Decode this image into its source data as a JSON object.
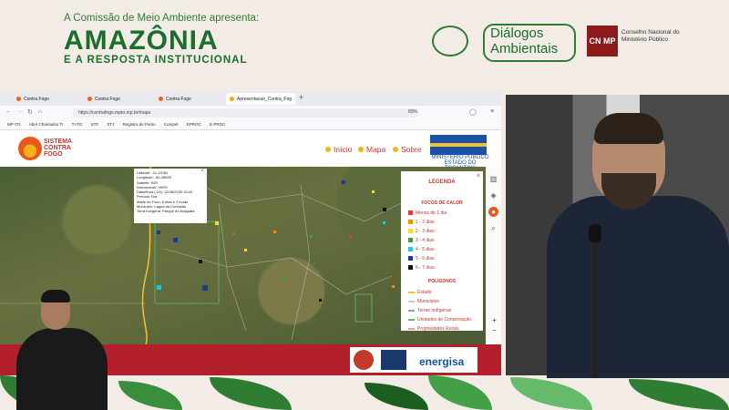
{
  "header": {
    "subtitle": "A Comissão de Meio Ambiente apresenta:",
    "title": "AMAZÔNIA",
    "tagline": "E A RESPOSTA INSTITUCIONAL",
    "dialogos_line1": "Diálogos",
    "dialogos_line2": "Ambientais",
    "cnmp_abbr": "CN MP",
    "cnmp_name": "Conselho Nacional do Ministério Público"
  },
  "browser": {
    "tabs": [
      {
        "label": "Contra Fogo"
      },
      {
        "label": "Contra Fogo"
      },
      {
        "label": "Contra Fogo"
      },
      {
        "label": "Apresentacao_Contra_Fogo_Dia"
      }
    ],
    "url": "https://contrafogo.mpto.mp.br/mapa",
    "zoom": "80%",
    "bookmarks": [
      "MP-TO",
      "Abrir Chamados TI",
      "TI-TO",
      "STF",
      "STJ",
      "Registro de Ponto",
      "Compel",
      "EPROC",
      "E-PROC"
    ]
  },
  "site": {
    "logo_line1": "SISTEMA",
    "logo_line2": "CONTRA",
    "logo_line3": "FOGO",
    "nav": [
      "Início",
      "Mapa",
      "Sobre"
    ],
    "mp_line1": "MINISTÉRIO PÚBLICO",
    "mp_line2": "ESTADO DO TOCANTINS"
  },
  "popup": {
    "lines": [
      "Latitude: -11.12081",
      "Longitude: -50.49695",
      "Satelite: N20",
      "Instrumento: VIIRS",
      "Data/Hora (-03): 12/08/2025 15:43",
      "Período: Dia",
      "Idade do Foco: 6 dias e 2 horas",
      "Município: Lagoa da Confusão",
      "Terra Indígena: Parque do Araguaia"
    ]
  },
  "legend": {
    "title": "LEGENDA",
    "focos_title": "FOCOS DE CALOR",
    "focos": [
      {
        "label": "Menos de 1 dia",
        "color": "#e53935"
      },
      {
        "label": "1 - 2 dias",
        "color": "#fb8c00"
      },
      {
        "label": "2 - 3 dias",
        "color": "#fdd835"
      },
      {
        "label": "3 - 4 dias",
        "color": "#43a047"
      },
      {
        "label": "4 - 5 dias",
        "color": "#26c6da"
      },
      {
        "label": "5 - 6 dias",
        "color": "#1e3a8a"
      },
      {
        "label": "6 - 7 dias",
        "color": "#111111"
      }
    ],
    "poligonos_title": "POLÍGONOS",
    "poligonos": [
      {
        "label": "Estado",
        "color": "#f2c230"
      },
      {
        "label": "Municípios",
        "color": "#cccccc"
      },
      {
        "label": "Terras Indígenas",
        "color": "#9e9e9e"
      },
      {
        "label": "Unidades de Conservação",
        "color": "#66bb6a"
      },
      {
        "label": "Propriedades Rurais",
        "color": "#ef9a9a"
      }
    ]
  },
  "footer": {
    "energisa": "energisa"
  }
}
